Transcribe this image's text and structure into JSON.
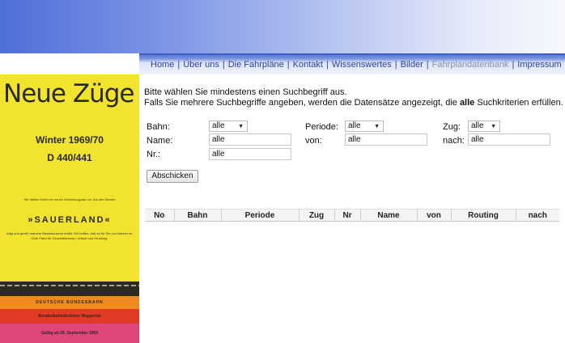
{
  "nav": {
    "items": [
      {
        "label": "Home",
        "active": false
      },
      {
        "label": "Über uns",
        "active": false
      },
      {
        "label": "Die Fahrpläne",
        "active": false
      },
      {
        "label": "Kontakt",
        "active": false
      },
      {
        "label": "Wissenswertes",
        "active": false
      },
      {
        "label": "Bilder",
        "active": false
      },
      {
        "label": "Fahrplandatenbank",
        "active": true
      },
      {
        "label": "Impressum",
        "active": false
      }
    ],
    "separator": "|"
  },
  "cover": {
    "title": "Neue Züge",
    "season": "Winter 1969/70",
    "number": "D 440/441",
    "intro_small": "Wir stellen Ihnen ein neues Schnellzugpaar vor, Als den Namen",
    "name": "»SAUERLAND«",
    "body_small": "trägt und gewiß manche Reisewünsche erfüllt. Wir hoffen, daß es für Sie von Nutzen ist. Gute Fahrt für Geschäftsreisen, Urlaub und Erholung.",
    "railway": "DEUTSCHE BUNDESBAHN",
    "directorate": "Bundesbahndirektion Wuppertal",
    "valid": "Gültig ab 28. September 1969"
  },
  "form": {
    "intro_line1": "Bitte wählen Sie mindestens einen Suchbegriff aus.",
    "intro_line2_pre": "Falls Sie mehrere Suchbegriffe angeben, werden die Datensätze angezeigt, die ",
    "intro_line2_bold": "alle",
    "intro_line2_post": " Suchkriterien erfüllen.",
    "bahn_label": "Bahn:",
    "bahn_value": "alle",
    "periode_label": "Periode:",
    "periode_value": "alle",
    "zug_label": "Zug:",
    "zug_value": "alle",
    "name_label": "Name:",
    "name_value": "alle",
    "von_label": "von:",
    "von_value": "alle",
    "nach_label": "nach:",
    "nach_value": "alle",
    "nr_label": "Nr.:",
    "nr_value": "alle",
    "submit_label": "Abschicken"
  },
  "results": {
    "columns": [
      "No",
      "Bahn",
      "Periode",
      "Zug",
      "Nr",
      "Name",
      "von",
      "Routing",
      "nach"
    ]
  }
}
